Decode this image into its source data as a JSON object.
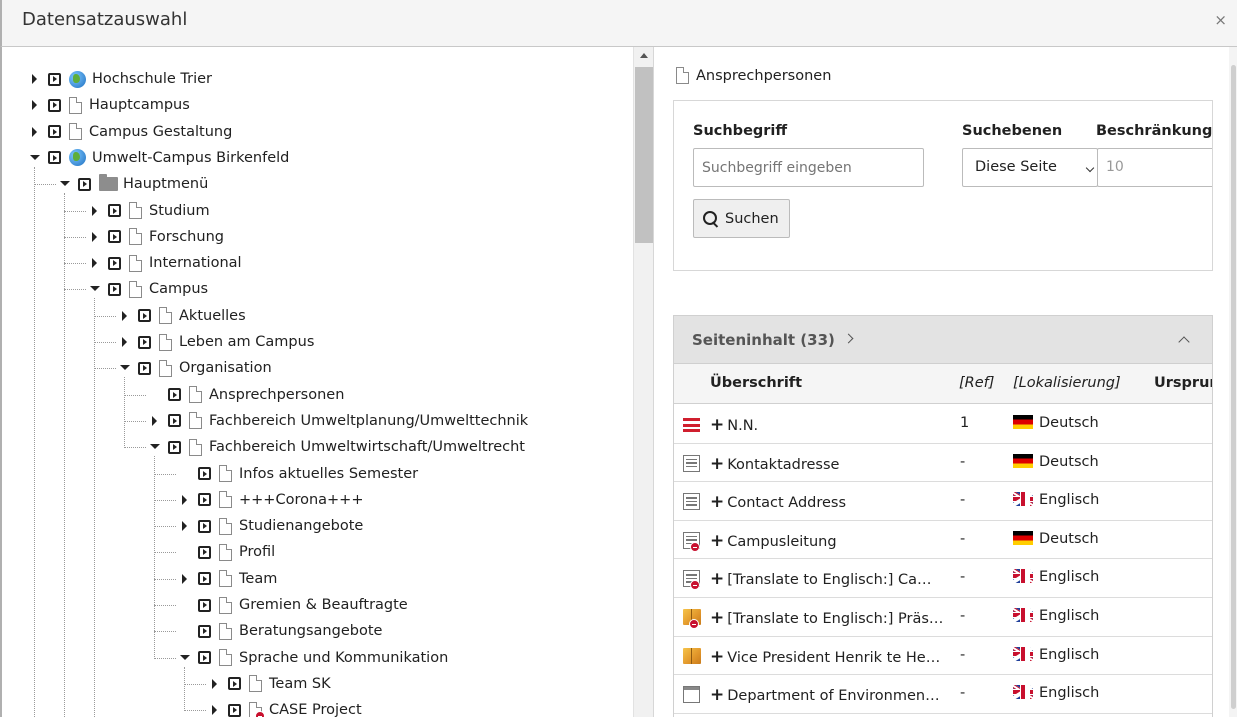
{
  "window": {
    "title": "Datensatzauswahl",
    "close_label": "×"
  },
  "tree": [
    {
      "label": "Hochschule Trier",
      "icon": "globe-icon",
      "state": "closed",
      "depth": 0
    },
    {
      "label": "Hauptcampus",
      "icon": "page-icon",
      "state": "closed",
      "depth": 0
    },
    {
      "label": "Campus Gestaltung",
      "icon": "page-icon",
      "state": "closed",
      "depth": 0
    },
    {
      "label": "Umwelt-Campus Birkenfeld",
      "icon": "globe-icon",
      "state": "open",
      "depth": 0
    },
    {
      "label": "Hauptmenü",
      "icon": "folder-icon",
      "state": "open",
      "depth": 1
    },
    {
      "label": "Studium",
      "icon": "page-icon",
      "state": "closed",
      "depth": 2
    },
    {
      "label": "Forschung",
      "icon": "page-icon",
      "state": "closed",
      "depth": 2
    },
    {
      "label": "International",
      "icon": "page-icon",
      "state": "closed",
      "depth": 2
    },
    {
      "label": "Campus",
      "icon": "page-icon",
      "state": "open",
      "depth": 2
    },
    {
      "label": "Aktuelles",
      "icon": "page-icon",
      "state": "closed",
      "depth": 3
    },
    {
      "label": "Leben am Campus",
      "icon": "page-icon",
      "state": "closed",
      "depth": 3
    },
    {
      "label": "Organisation",
      "icon": "page-icon",
      "state": "open",
      "depth": 3
    },
    {
      "label": "Ansprechpersonen",
      "icon": "page-icon",
      "state": "none",
      "depth": 4
    },
    {
      "label": "Fachbereich Umweltplanung/Umwelttechnik",
      "icon": "page-icon",
      "state": "closed",
      "depth": 4
    },
    {
      "label": "Fachbereich Umweltwirtschaft/Umweltrecht",
      "icon": "page-icon",
      "state": "open",
      "depth": 4
    },
    {
      "label": "Infos aktuelles Semester",
      "icon": "page-icon",
      "state": "none",
      "depth": 5
    },
    {
      "label": "+++Corona+++",
      "icon": "page-icon",
      "state": "closed",
      "depth": 5
    },
    {
      "label": "Studienangebote",
      "icon": "page-icon",
      "state": "closed",
      "depth": 5
    },
    {
      "label": "Profil",
      "icon": "page-icon",
      "state": "none",
      "depth": 5
    },
    {
      "label": "Team",
      "icon": "page-icon",
      "state": "closed",
      "depth": 5
    },
    {
      "label": "Gremien & Beauftragte",
      "icon": "page-icon",
      "state": "none",
      "depth": 5
    },
    {
      "label": "Beratungsangebote",
      "icon": "page-icon",
      "state": "none",
      "depth": 5
    },
    {
      "label": "Sprache und Kommunikation",
      "icon": "page-icon",
      "state": "open",
      "depth": 5
    },
    {
      "label": "Team SK",
      "icon": "page-icon",
      "state": "closed",
      "depth": 6
    },
    {
      "label": "CASE Project",
      "icon": "page-hidden-icon",
      "state": "closed",
      "depth": 6
    }
  ],
  "right": {
    "page_title": "Ansprechpersonen",
    "search": {
      "term_label": "Suchbegriff",
      "term_placeholder": "Suchbegriff eingeben",
      "levels_label": "Suchebenen",
      "levels_value": "Diese Seite",
      "limit_label": "Beschränkung",
      "limit_placeholder": "10",
      "button_label": "Suchen"
    },
    "content": {
      "title": "Seiteninhalt (33)",
      "columns": [
        "Überschrift",
        "[Ref]",
        "[Lokalisierung]",
        "Ursprung"
      ],
      "rows": [
        {
          "icon": "hamburger-icon",
          "heading": "N.N.",
          "ref": "1",
          "lang": "Deutsch",
          "flag": "de"
        },
        {
          "icon": "text-element-icon",
          "heading": "Kontaktadresse",
          "ref": "-",
          "lang": "Deutsch",
          "flag": "de"
        },
        {
          "icon": "text-element-icon",
          "heading": "Contact Address",
          "ref": "-",
          "lang": "Englisch",
          "flag": "gb"
        },
        {
          "icon": "hidden-element-icon",
          "heading": "Campusleitung",
          "ref": "-",
          "lang": "Deutsch",
          "flag": "de"
        },
        {
          "icon": "hidden-element-icon",
          "heading": "[Translate to Englisch:] Campusleitung",
          "ref": "-",
          "lang": "Englisch",
          "flag": "gb"
        },
        {
          "icon": "hidden-plugin-icon",
          "heading": "[Translate to Englisch:] Präsident",
          "ref": "-",
          "lang": "Englisch",
          "flag": "gb"
        },
        {
          "icon": "plugin-icon",
          "heading": "Vice President Henrik te Heesen",
          "ref": "-",
          "lang": "Englisch",
          "flag": "gb"
        },
        {
          "icon": "window-element-icon",
          "heading": "Department of Environmental Planning",
          "ref": "-",
          "lang": "Englisch",
          "flag": "gb"
        }
      ]
    }
  }
}
